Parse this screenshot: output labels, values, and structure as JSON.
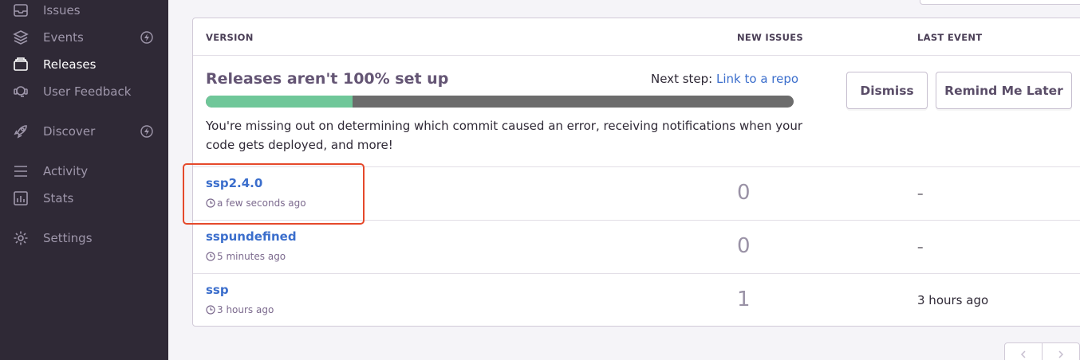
{
  "sidebar": {
    "items": [
      {
        "label": "Issues",
        "icon": "inbox-icon",
        "active": false
      },
      {
        "label": "Events",
        "icon": "layers-icon",
        "active": false,
        "badge": "lightning-badge-icon"
      },
      {
        "label": "Releases",
        "icon": "package-icon",
        "active": true
      },
      {
        "label": "User Feedback",
        "icon": "support-icon",
        "active": false
      },
      {
        "label": "Discover",
        "icon": "rocket-icon",
        "active": false,
        "badge": "lightning-badge-icon"
      },
      {
        "label": "Activity",
        "icon": "menu-lines-icon",
        "active": false
      },
      {
        "label": "Stats",
        "icon": "bar-chart-icon",
        "active": false
      },
      {
        "label": "Settings",
        "icon": "gear-icon",
        "active": false
      }
    ]
  },
  "table": {
    "columns": [
      "VERSION",
      "NEW ISSUES",
      "LAST EVENT"
    ]
  },
  "setup": {
    "title": "Releases aren't 100% set up",
    "next_step_label": "Next step:",
    "next_step_link": "Link to a repo",
    "progress_fraction": 0.25,
    "description": "You're missing out on determining which commit caused an error, receiving notifications when your code gets deployed, and more!",
    "dismiss_label": "Dismiss",
    "remind_label": "Remind Me Later"
  },
  "releases": [
    {
      "version": "ssp2.4.0",
      "time": "a few seconds ago",
      "new_issues": "0",
      "last_event": "–"
    },
    {
      "version": "sspundefined",
      "time": "5 minutes ago",
      "new_issues": "0",
      "last_event": "–"
    },
    {
      "version": "ssp",
      "time": "3 hours ago",
      "new_issues": "1",
      "last_event": "3 hours ago"
    }
  ],
  "colors": {
    "sidebar_bg": "#2f2936",
    "link": "#3b6ecc",
    "progress_fill": "#6fc799",
    "progress_track": "#6c6c6c",
    "highlight": "#e5492b"
  }
}
